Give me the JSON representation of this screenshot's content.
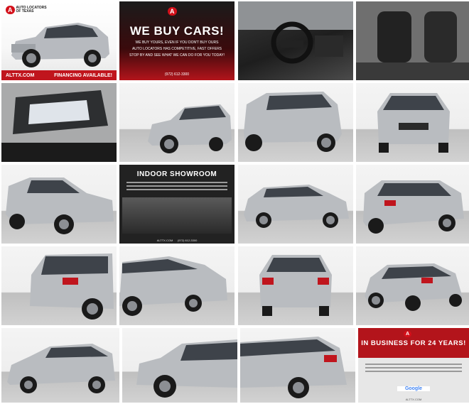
{
  "gallery": {
    "tiles": [
      {
        "kind": "hero",
        "label": "Front three-quarter view of silver SUV",
        "logo_mark": "A",
        "logo_line1": "AUTO LOCATORS",
        "logo_line2": "OF TEXAS",
        "bar_site": "ALTTX.COM",
        "bar_cta": "FINANCING AVAILABLE!"
      },
      {
        "kind": "promo",
        "label": "We buy cars promotion",
        "logo_mark": "A",
        "headline": "WE BUY CARS!",
        "line1": "WE BUY YOURS, EVEN IF YOU DON'T BUY OURS",
        "line2": "AUTO LOCATORS HAS COMPETITIVE, FAST OFFERS",
        "line3": "STOP BY AND SEE WHAT WE CAN DO FOR YOU TODAY!",
        "phone": "(972) 612-3300"
      },
      {
        "kind": "interior",
        "label": "Dashboard and steering wheel"
      },
      {
        "kind": "interior",
        "label": "Front seats"
      },
      {
        "kind": "roof",
        "label": "Sunroof interior view"
      },
      {
        "kind": "studio",
        "label": "Front three-quarter view"
      },
      {
        "kind": "studio",
        "label": "Side three-quarter view"
      },
      {
        "kind": "studio",
        "label": "Front view"
      },
      {
        "kind": "studio",
        "label": "Front three-quarter close"
      },
      {
        "kind": "showroom",
        "label": "Indoor showroom promotion",
        "headline": "INDOOR SHOWROOM",
        "site": "ALTTX.COM",
        "phone": "(972) 612-3300"
      },
      {
        "kind": "studio",
        "label": "Side profile"
      },
      {
        "kind": "studio",
        "label": "Rear three-quarter view"
      },
      {
        "kind": "studio",
        "label": "Rear left three-quarter"
      },
      {
        "kind": "studio",
        "label": "Left side with doors"
      },
      {
        "kind": "studio",
        "label": "Rear view"
      },
      {
        "kind": "studio",
        "label": "Rear right three-quarter"
      },
      {
        "kind": "studio",
        "label": "Front left profile"
      },
      {
        "kind": "studio",
        "label": "Side close-up"
      },
      {
        "kind": "studio",
        "label": "Rear corner close-up"
      },
      {
        "kind": "business",
        "label": "In business for 24 years promotion",
        "headline": "IN BUSINESS FOR 24 YEARS!",
        "logo_mark": "A",
        "review_name": "Google",
        "site": "ALTTX.COM"
      }
    ]
  },
  "colors": {
    "brand_red": "#c0151d",
    "car_silver": "#b9bcc0"
  },
  "icons": [
    "car-icon",
    "logo-icon",
    "google-icon"
  ]
}
